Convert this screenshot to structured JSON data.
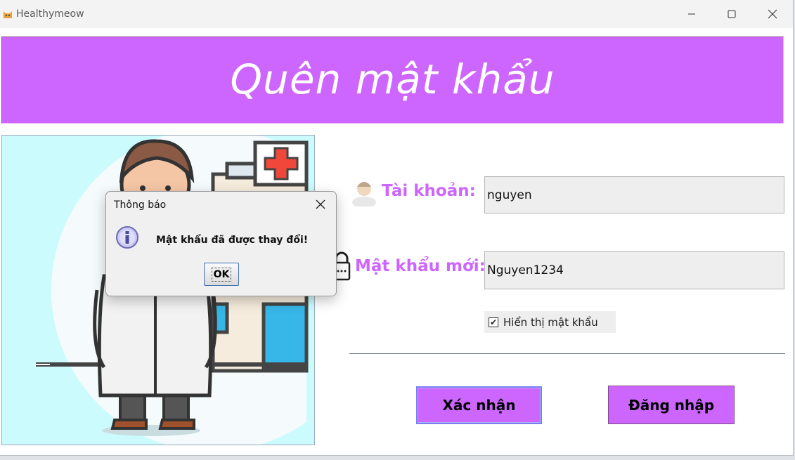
{
  "window": {
    "title": "Healthymeow"
  },
  "header": {
    "title": "Quên mật khẩu"
  },
  "form": {
    "username_label": "Tài khoản:",
    "username_value": "nguyen",
    "password_label": "Mật khẩu mới:",
    "password_value": "Nguyen1234",
    "show_password_label": "Hiển thị mật khẩu",
    "show_password_checked": true
  },
  "buttons": {
    "confirm_label": "Xác nhận",
    "login_label": "Đăng nhập"
  },
  "dialog": {
    "title": "Thông báo",
    "message": "Mật khẩu đã được thay đổi!",
    "ok_label": "OK",
    "icon": "info-icon"
  },
  "colors": {
    "accent": "#cc66ff",
    "title_bar": "#f3f3f3",
    "illustration_bg": "#ccfbfd"
  }
}
